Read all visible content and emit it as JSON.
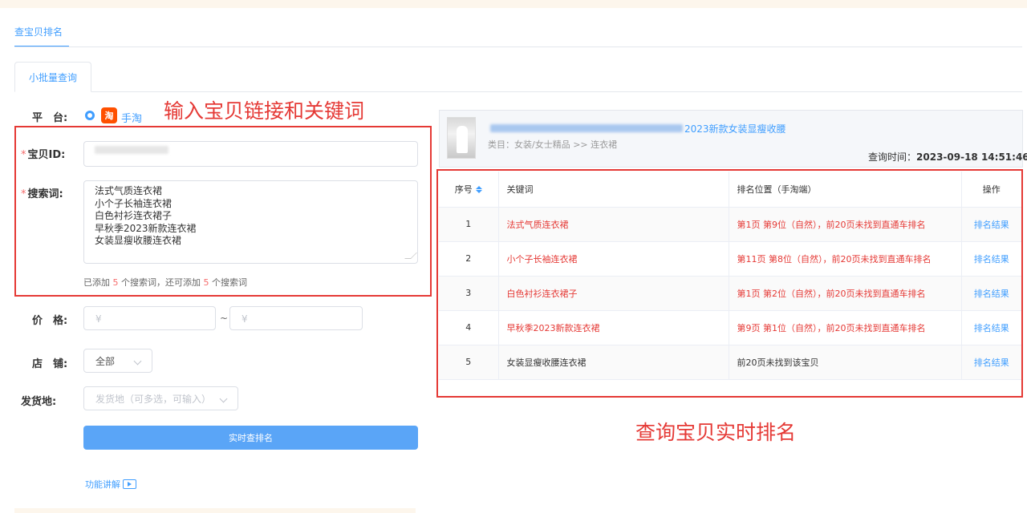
{
  "tabs": {
    "main": "查宝贝排名",
    "sub": "小批量查询"
  },
  "form": {
    "platform_label": "平　台:",
    "platform_option": "手淘",
    "platform_icon": "淘",
    "item_id_label": "宝贝ID:",
    "keywords_label": "搜索词:",
    "keywords": [
      "法式气质连衣裙",
      "小个子长袖连衣裙",
      "白色衬衫连衣裙子",
      "早秋季2023新款连衣裙",
      "女装显瘦收腰连衣裙"
    ],
    "hint_prefix": "已添加 ",
    "hint_added": "5",
    "hint_middle": " 个搜索词，还可添加 ",
    "hint_remaining": "5",
    "hint_suffix": " 个搜索词",
    "price_label": "价　格:",
    "price_min_placeholder": "¥",
    "price_max_placeholder": "¥",
    "price_separator": "~",
    "store_label": "店　铺:",
    "store_value": "全部",
    "ship_label": "发货地:",
    "ship_placeholder": "发货地（可多选，可输入）",
    "submit_label": "实时查排名",
    "help_link": "功能讲解"
  },
  "annotations": {
    "left": "输入宝贝链接和关键词",
    "right": "查询宝贝实时排名"
  },
  "product": {
    "title": "2023新款女装显瘦收腰",
    "category": "类目：女装/女士精品 >> 连衣裙",
    "query_time_label": "查询时间：",
    "query_time": "2023-09-18 14:51:46"
  },
  "table": {
    "headers": {
      "seq": "序号",
      "keyword": "关键词",
      "position": "排名位置（手淘端）",
      "action": "操作"
    },
    "rows": [
      {
        "seq": "1",
        "keyword": "法式气质连衣裙",
        "position": "第1页 第9位（自然），前20页未找到直通车排名",
        "action": "排名结果"
      },
      {
        "seq": "2",
        "keyword": "小个子长袖连衣裙",
        "position": "第11页 第8位（自然），前20页未找到直通车排名",
        "action": "排名结果"
      },
      {
        "seq": "3",
        "keyword": "白色衬衫连衣裙子",
        "position": "第1页 第2位（自然），前20页未找到直通车排名",
        "action": "排名结果"
      },
      {
        "seq": "4",
        "keyword": "早秋季2023新款连衣裙",
        "position": "第9页 第1位（自然），前20页未找到直通车排名",
        "action": "排名结果"
      },
      {
        "seq": "5",
        "keyword": "女装显瘦收腰连衣裙",
        "position": "前20页未找到该宝贝",
        "action": "排名结果"
      }
    ]
  },
  "colors": {
    "accent": "#409eff",
    "highlight_red": "#e53935",
    "button": "#5aa5f7"
  }
}
